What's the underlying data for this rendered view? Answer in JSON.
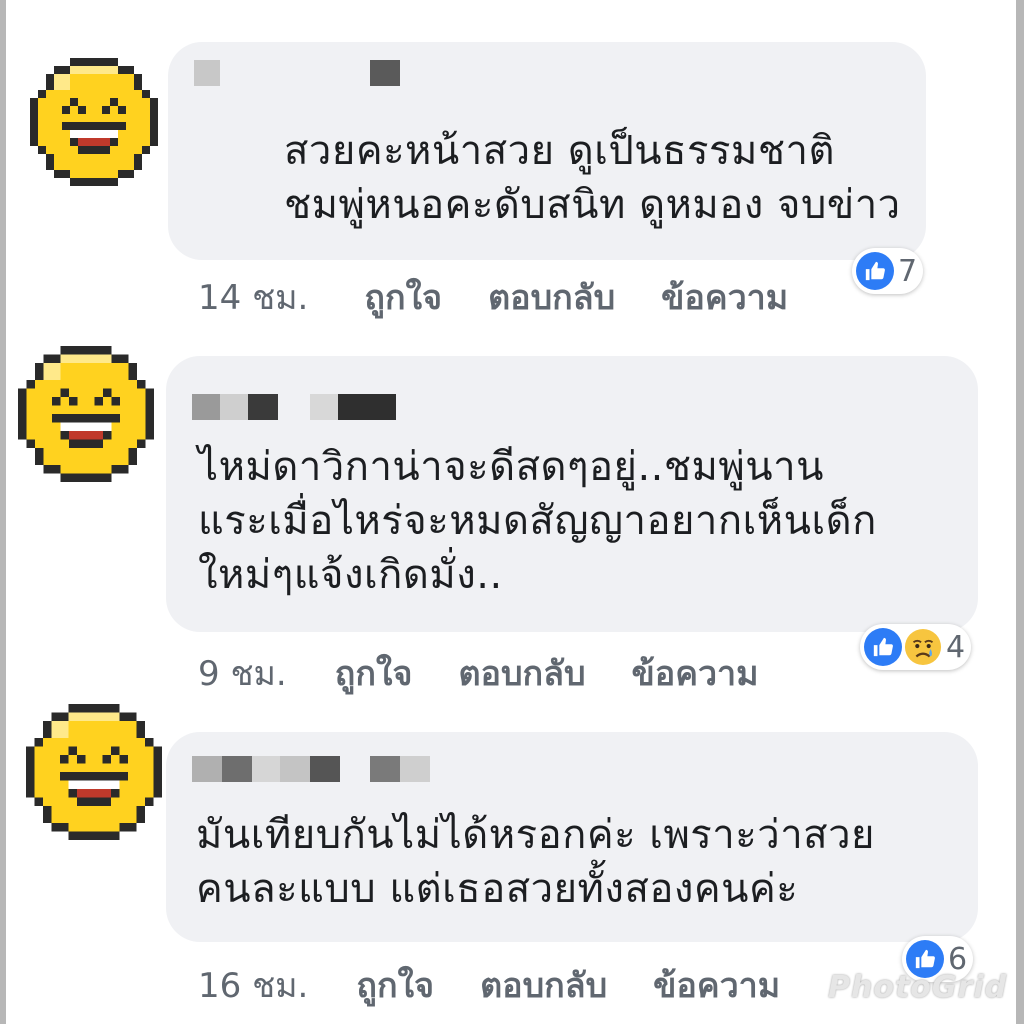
{
  "comments": [
    {
      "text": "สวยคะหน้าสวย ดูเป็นธรรมชาติ\nชมพู่หนอคะดับสนิท ดูหมอง จบข่าว",
      "time": "14 ชม.",
      "like_label": "ถูกใจ",
      "reply_label": "ตอบกลับ",
      "message_label": "ข้อความ",
      "reaction_count": "7",
      "reactions": [
        "like-icon"
      ]
    },
    {
      "text": "ไหม่ดาวิกาน่าจะดีสดๆอยู่..ชมพู่นาน\nแระเมื่อไหร่จะหมดสัญญาอยากเห็นเด็ก\nใหม่ๆแจ้งเกิดมั่ง..",
      "time": "9 ชม.",
      "like_label": "ถูกใจ",
      "reply_label": "ตอบกลับ",
      "message_label": "ข้อความ",
      "reaction_count": "4",
      "reactions": [
        "like-icon",
        "sad-icon"
      ]
    },
    {
      "text": "มันเทียบกันไม่ได้หรอกค่ะ เพราะว่าสวย\nคนละแบบ แต่เธอสวยทั้งสองคนค่ะ",
      "time": "16 ชม.",
      "like_label": "ถูกใจ",
      "reply_label": "ตอบกลับ",
      "message_label": "ข้อความ",
      "reaction_count": "6",
      "reactions": [
        "like-icon"
      ]
    }
  ],
  "watermark": "PhotoGrid",
  "colors": {
    "bubble": "#f0f1f4",
    "text": "#1c1e21",
    "meta": "#606770",
    "like_blue": "#2d7cf6",
    "emoji_yellow": "#ffd21f",
    "emoji_outline": "#2a2a2a"
  }
}
